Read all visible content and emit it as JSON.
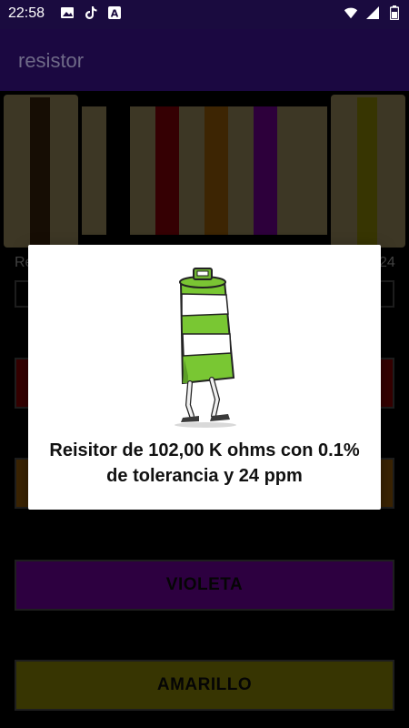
{
  "status_bar": {
    "time": "22:58",
    "left_icons": [
      "image-icon",
      "tiktok-icon",
      "text-a-icon"
    ],
    "right_icons": [
      "wifi-icon",
      "signal-icon",
      "battery-icon"
    ]
  },
  "app_bar": {
    "title": "resistor"
  },
  "resistor": {
    "body_color": "#7b6f4a",
    "band_colors": [
      "#2d1b08",
      "#6a0007",
      "#7a4a06",
      "#5b0076",
      "#6f6b05"
    ]
  },
  "background_labels": {
    "left": "Re",
    "right": "24"
  },
  "buttons": [
    {
      "label": "",
      "color": "#000000"
    },
    {
      "label": "",
      "color": "#6e0000"
    },
    {
      "label": "",
      "color": "#7a4a06"
    },
    {
      "label": "VIOLETA",
      "color": "#5b0080"
    },
    {
      "label": "AMARILLO",
      "color": "#6f6a05"
    }
  ],
  "dialog": {
    "message": "Reisitor de 102,00 K ohms con 0.1% de tolerancia y 24 ppm",
    "illustration": "walking-traffic-barrel-icon"
  }
}
